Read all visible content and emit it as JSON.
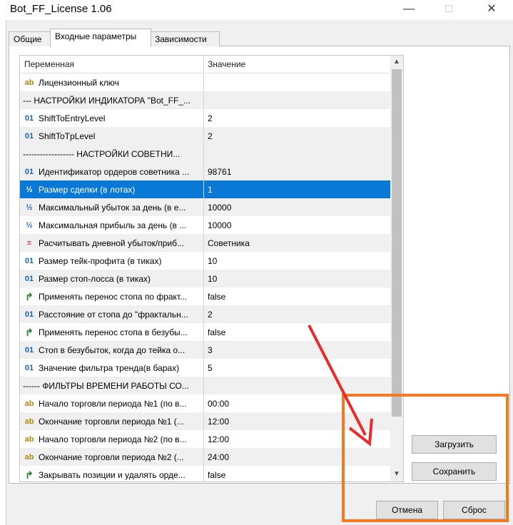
{
  "window": {
    "title": "Bot_FF_License 1.06"
  },
  "tabs": [
    "Общие",
    "Входные параметры",
    "Зависимости"
  ],
  "grid": {
    "col_variable": "Переменная",
    "col_value": "Значение",
    "rows": [
      {
        "type": "ab",
        "name": "Лицензионный ключ",
        "value": ""
      },
      {
        "type": "sep",
        "name": "---   НАСТРОЙКИ ИНДИКАТОРА \"Bot_FF_...",
        "value": ""
      },
      {
        "type": "num",
        "name": "ShiftToEntryLevel",
        "value": "2"
      },
      {
        "type": "num",
        "name": "ShiftToTpLevel",
        "value": "2"
      },
      {
        "type": "sep",
        "name": "------------------    НАСТРОЙКИ СОВЕТНИ...",
        "value": ""
      },
      {
        "type": "num",
        "name": "Идентификатор ордеров советника ...",
        "value": "98761"
      },
      {
        "type": "frac",
        "name": "Размер сделки (в лотах)",
        "value": "1"
      },
      {
        "type": "frac",
        "name": "Максимальный убыток за день (в е...",
        "value": "10000"
      },
      {
        "type": "frac",
        "name": "Максимальная прибыль за день (в ...",
        "value": "10000"
      },
      {
        "type": "en",
        "name": "Расчитывать дневной убыток/приб...",
        "value": "Советника"
      },
      {
        "type": "num",
        "name": "Размер тейк-профита (в тиках)",
        "value": "10"
      },
      {
        "type": "num",
        "name": "Размер стоп-лосса (в тиках)",
        "value": "10"
      },
      {
        "type": "bool",
        "name": "Применять перенос стопа по фракт...",
        "value": "false"
      },
      {
        "type": "num",
        "name": "Расстояние от стопа до \"фрактальн...",
        "value": "2"
      },
      {
        "type": "bool",
        "name": "Применять перенос стопа в безубы...",
        "value": "false"
      },
      {
        "type": "num",
        "name": "Стоп в безубыток, когда до тейка о...",
        "value": "3"
      },
      {
        "type": "num",
        "name": "Значение фильтра тренда(в барах)",
        "value": "5"
      },
      {
        "type": "sep",
        "name": "------    ФИЛЬТРЫ ВРЕМЕНИ РАБОТЫ СО...",
        "value": ""
      },
      {
        "type": "ab",
        "name": "Начало торговли периода №1 (по в...",
        "value": "00:00"
      },
      {
        "type": "ab",
        "name": "Окончание торговли периода №1 (...",
        "value": "12:00"
      },
      {
        "type": "ab",
        "name": "Начало торговли периода №2 (по в...",
        "value": "12:00"
      },
      {
        "type": "ab",
        "name": "Окончание торговли периода №2 (...",
        "value": "24:00"
      },
      {
        "type": "bool",
        "name": "Закрывать позиции и удалять орде...",
        "value": "false"
      }
    ],
    "selected_value": "1"
  },
  "icons": {
    "num": "01",
    "ab": "ab",
    "frac": "½",
    "en": "≡",
    "bool": "↱"
  },
  "buttons": {
    "load": "Загрузить",
    "save": "Сохранить",
    "cancel": "Отмена",
    "reset": "Сброс"
  },
  "colors": {
    "selection": "#0a78d7",
    "highlight_box": "#f47920",
    "arrow": "#e82b2b"
  }
}
